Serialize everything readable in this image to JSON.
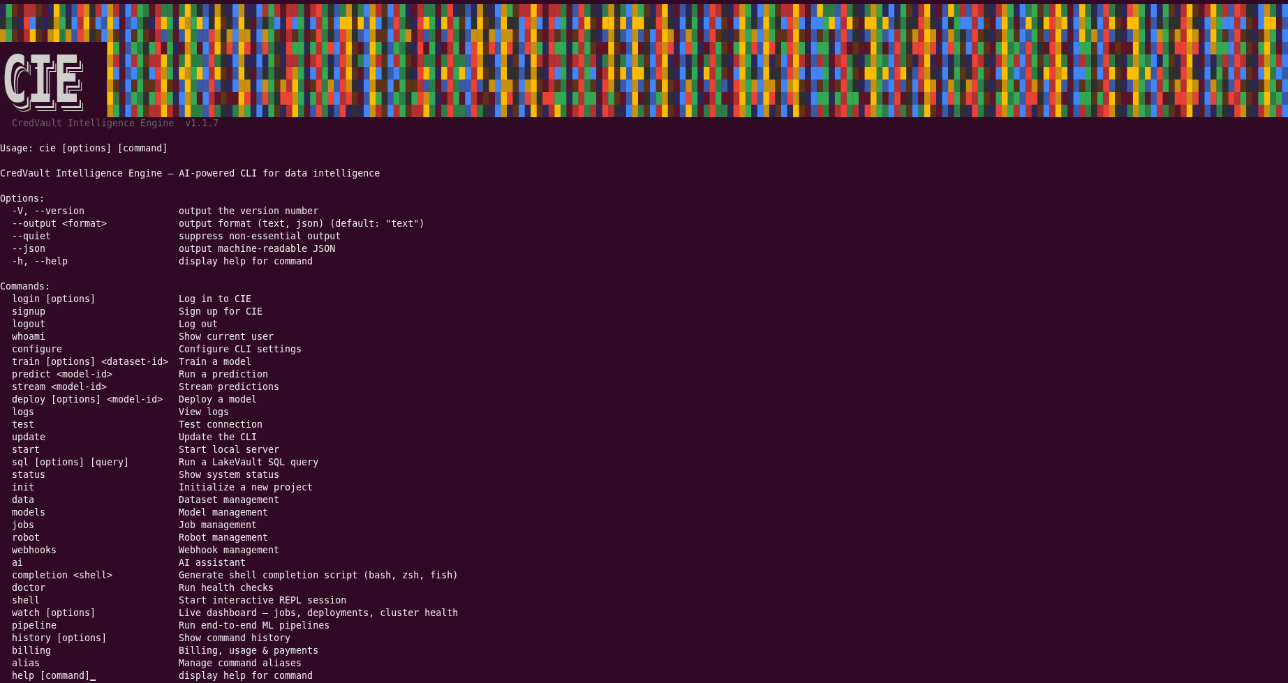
{
  "banner": {
    "logo": "CIE",
    "subtitle": "CredVault Intelligence Engine  v1.1.7"
  },
  "usage": "Usage: cie [options] [command]",
  "description": "CredVault Intelligence Engine — AI-powered CLI for data intelligence",
  "options": {
    "heading": "Options:",
    "items": [
      {
        "flag": "-V, --version",
        "text": "output the version number"
      },
      {
        "flag": "--output <format>",
        "text": "output format (text, json) (default: \"text\")"
      },
      {
        "flag": "--quiet",
        "text": "suppress non-essential output"
      },
      {
        "flag": "--json",
        "text": "output machine-readable JSON"
      },
      {
        "flag": "-h, --help",
        "text": "display help for command"
      }
    ]
  },
  "commands": {
    "heading": "Commands:",
    "items": [
      {
        "flag": "login [options]",
        "text": "Log in to CIE"
      },
      {
        "flag": "signup",
        "text": "Sign up for CIE"
      },
      {
        "flag": "logout",
        "text": "Log out"
      },
      {
        "flag": "whoami",
        "text": "Show current user"
      },
      {
        "flag": "configure",
        "text": "Configure CLI settings"
      },
      {
        "flag": "train [options] <dataset-id>",
        "text": "Train a model"
      },
      {
        "flag": "predict <model-id>",
        "text": "Run a prediction"
      },
      {
        "flag": "stream <model-id>",
        "text": "Stream predictions"
      },
      {
        "flag": "deploy [options] <model-id>",
        "text": "Deploy a model"
      },
      {
        "flag": "logs",
        "text": "View logs"
      },
      {
        "flag": "test",
        "text": "Test connection"
      },
      {
        "flag": "update",
        "text": "Update the CLI"
      },
      {
        "flag": "start",
        "text": "Start local server"
      },
      {
        "flag": "sql [options] [query]",
        "text": "Run a LakeVault SQL query"
      },
      {
        "flag": "status",
        "text": "Show system status"
      },
      {
        "flag": "init",
        "text": "Initialize a new project"
      },
      {
        "flag": "data",
        "text": "Dataset management"
      },
      {
        "flag": "models",
        "text": "Model management"
      },
      {
        "flag": "jobs",
        "text": "Job management"
      },
      {
        "flag": "robot",
        "text": "Robot management"
      },
      {
        "flag": "webhooks",
        "text": "Webhook management"
      },
      {
        "flag": "ai",
        "text": "AI assistant"
      },
      {
        "flag": "completion <shell>",
        "text": "Generate shell completion script (bash, zsh, fish)"
      },
      {
        "flag": "doctor",
        "text": "Run health checks"
      },
      {
        "flag": "shell",
        "text": "Start interactive REPL session"
      },
      {
        "flag": "watch [options]",
        "text": "Live dashboard — jobs, deployments, cluster health"
      },
      {
        "flag": "pipeline",
        "text": "Run end-to-end ML pipelines"
      },
      {
        "flag": "history [options]",
        "text": "Show command history"
      },
      {
        "flag": "billing",
        "text": "Billing, usage & payments"
      },
      {
        "flag": "alias",
        "text": "Manage command aliases"
      },
      {
        "flag": "help [command]",
        "text": "display help for command",
        "cursor": true
      }
    ]
  }
}
